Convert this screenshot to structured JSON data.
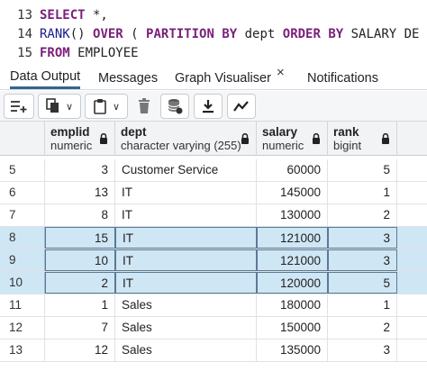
{
  "editor": {
    "lines": [
      {
        "number": "13",
        "tokens": [
          {
            "t": "SELECT",
            "k": "kw"
          },
          {
            "t": " *,",
            "k": ""
          }
        ]
      },
      {
        "number": "14",
        "tokens": [
          {
            "t": "RANK",
            "k": "fn"
          },
          {
            "t": "() ",
            "k": ""
          },
          {
            "t": "OVER",
            "k": "kw"
          },
          {
            "t": " ( ",
            "k": ""
          },
          {
            "t": "PARTITION BY",
            "k": "kw"
          },
          {
            "t": " dept ",
            "k": ""
          },
          {
            "t": "ORDER BY",
            "k": "kw"
          },
          {
            "t": " SALARY DE",
            "k": ""
          }
        ]
      },
      {
        "number": "15",
        "tokens": [
          {
            "t": "FROM",
            "k": "kw"
          },
          {
            "t": " EMPLOYEE",
            "k": ""
          }
        ]
      }
    ]
  },
  "tabs": [
    {
      "label": "Data Output",
      "active": true
    },
    {
      "label": "Messages",
      "active": false
    },
    {
      "label": "Graph Visualiser",
      "active": false,
      "closable": true,
      "close_glyph": "×"
    },
    {
      "label": "Notifications",
      "active": false
    }
  ],
  "toolbar": {
    "buttons": [
      "add-row-icon",
      "copy-icon",
      "paste-icon",
      "delete-icon",
      "save-data-icon",
      "download-icon",
      "graph-icon"
    ],
    "dropdown_glyph": "∨"
  },
  "grid": {
    "columns": [
      {
        "name": "emplid",
        "type": "numeric"
      },
      {
        "name": "dept",
        "type": "character varying (255)"
      },
      {
        "name": "salary",
        "type": "numeric"
      },
      {
        "name": "rank",
        "type": "bigint"
      }
    ],
    "rows": [
      {
        "row_num": "5",
        "emplid": "3",
        "dept": "Customer Service",
        "salary": "60000",
        "rank": "5",
        "selected": false
      },
      {
        "row_num": "6",
        "emplid": "13",
        "dept": "IT",
        "salary": "145000",
        "rank": "1",
        "selected": false
      },
      {
        "row_num": "7",
        "emplid": "8",
        "dept": "IT",
        "salary": "130000",
        "rank": "2",
        "selected": false
      },
      {
        "row_num": "8",
        "emplid": "15",
        "dept": "IT",
        "salary": "121000",
        "rank": "3",
        "selected": true
      },
      {
        "row_num": "9",
        "emplid": "10",
        "dept": "IT",
        "salary": "121000",
        "rank": "3",
        "selected": true
      },
      {
        "row_num": "10",
        "emplid": "2",
        "dept": "IT",
        "salary": "120000",
        "rank": "5",
        "selected": true
      },
      {
        "row_num": "11",
        "emplid": "1",
        "dept": "Sales",
        "salary": "180000",
        "rank": "1",
        "selected": false
      },
      {
        "row_num": "12",
        "emplid": "7",
        "dept": "Sales",
        "salary": "150000",
        "rank": "2",
        "selected": false
      },
      {
        "row_num": "13",
        "emplid": "12",
        "dept": "Sales",
        "salary": "135000",
        "rank": "3",
        "selected": false
      }
    ]
  },
  "colors": {
    "keyword": "#7a1f7a",
    "function": "#1a1a8c",
    "active_tab_underline": "#326690",
    "selected_row_bg": "#cfe6f5"
  }
}
